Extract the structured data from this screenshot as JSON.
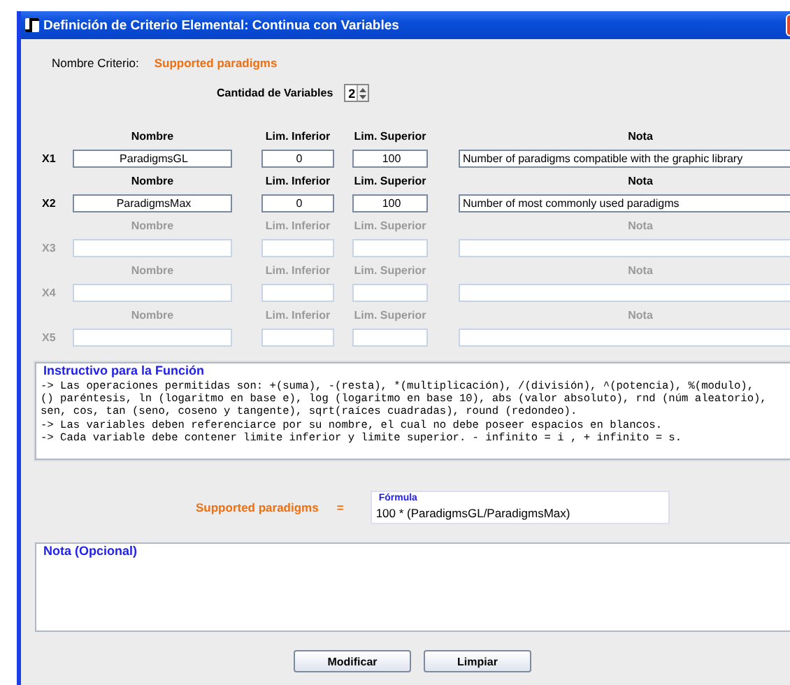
{
  "window": {
    "title": "Definición de Criterio Elemental: Continua con Variables"
  },
  "criterio": {
    "label": "Nombre Criterio:",
    "value": "Supported paradigms"
  },
  "cantidad": {
    "label": "Cantidad de Variables",
    "value": "2"
  },
  "variables": [
    {
      "label": "X1",
      "enabled": true,
      "headers": {
        "nombre": "Nombre",
        "inferior": "Lim. Inferior",
        "superior": "Lim. Superior",
        "nota": "Nota"
      },
      "nombre": "ParadigmsGL",
      "inferior": "0",
      "superior": "100",
      "nota": "Number of paradigms compatible with the graphic library"
    },
    {
      "label": "X2",
      "enabled": true,
      "headers": {
        "nombre": "Nombre",
        "inferior": "Lim. Inferior",
        "superior": "Lim. Superior",
        "nota": "Nota"
      },
      "nombre": "ParadigmsMax",
      "inferior": "0",
      "superior": "100",
      "nota": "Number of most commonly used paradigms"
    },
    {
      "label": "X3",
      "enabled": false,
      "headers": {
        "nombre": "Nombre",
        "inferior": "Lim. Inferior",
        "superior": "Lim. Superior",
        "nota": "Nota"
      }
    },
    {
      "label": "X4",
      "enabled": false,
      "headers": {
        "nombre": "Nombre",
        "inferior": "Lim. Inferior",
        "superior": "Lim. Superior",
        "nota": "Nota"
      }
    },
    {
      "label": "X5",
      "enabled": false,
      "headers": {
        "nombre": "Nombre",
        "inferior": "Lim. Inferior",
        "superior": "Lim. Superior",
        "nota": "Nota"
      }
    }
  ],
  "instructivo": {
    "title": "Instructivo para la Función",
    "lines": [
      "-> Las operaciones permitidas son: +(suma), -(resta), *(multiplicación), /(división), ^(potencia), %(modulo),",
      "() paréntesis, ln (logaritmo en base e), log (logaritmo en base 10), abs (valor absoluto), rnd (núm aleatorio),",
      "sen, cos, tan (seno, coseno y tangente), sqrt(raíces cuadradas), round (redondeo).",
      "-> Las variables deben referenciarce por su nombre, el cual no debe poseer espacios en blancos.",
      "-> Cada variable debe contener limite inferior y limite superior. - infinito = i , + infinito = s."
    ]
  },
  "formula": {
    "name": "Supported paradigms",
    "equals": "=",
    "legend": "Fórmula",
    "value": "100 * (ParadigmsGL/ParadigmsMax)"
  },
  "nota": {
    "legend": "Nota (Opcional)"
  },
  "buttons": [
    "Modificar",
    "Limpiar"
  ]
}
